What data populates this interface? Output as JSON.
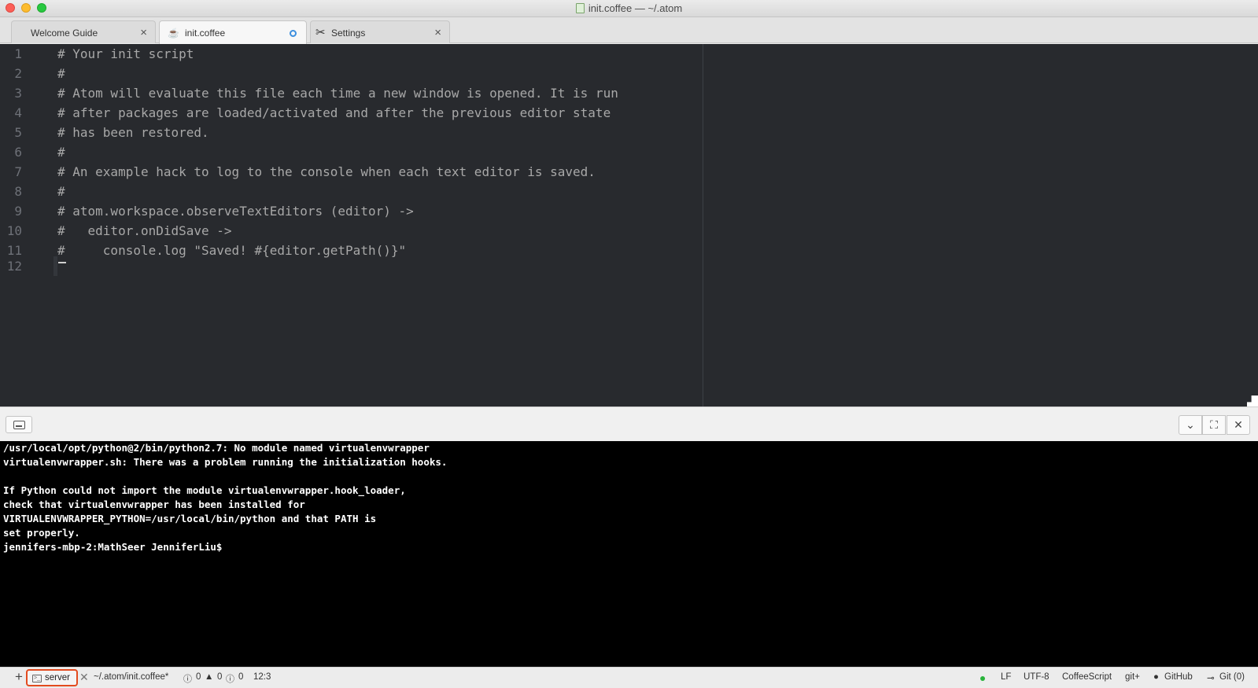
{
  "window": {
    "title": "init.coffee — ~/.atom"
  },
  "tabs": [
    {
      "label": "Welcome Guide",
      "state": "close"
    },
    {
      "label": "init.coffee",
      "state": "modified"
    },
    {
      "label": "Settings",
      "state": "close"
    }
  ],
  "editor": {
    "line_numbers": [
      "1",
      "2",
      "3",
      "4",
      "5",
      "6",
      "7",
      "8",
      "9",
      "10",
      "11",
      "12"
    ],
    "lines": [
      "# Your init script",
      "#",
      "# Atom will evaluate this file each time a new window is opened. It is run",
      "# after packages are loaded/activated and after the previous editor state",
      "# has been restored.",
      "#",
      "# An example hack to log to the console when each text editor is saved.",
      "#",
      "# atom.workspace.observeTextEditors (editor) ->",
      "#   editor.onDidSave ->",
      "#     console.log \"Saved! #{editor.getPath()}\"",
      ""
    ]
  },
  "terminal": {
    "lines": [
      "/usr/local/opt/python@2/bin/python2.7: No module named virtualenvwrapper",
      "virtualenvwrapper.sh: There was a problem running the initialization hooks.",
      "",
      "If Python could not import the module virtualenvwrapper.hook_loader,",
      "check that virtualenvwrapper has been installed for",
      "VIRTUALENVWRAPPER_PYTHON=/usr/local/bin/python and that PATH is",
      "set properly.",
      "jennifers-mbp-2:MathSeer JenniferLiu$"
    ]
  },
  "statusbar": {
    "add": "+",
    "terminal_tab": "server",
    "close": "✕",
    "file_path": "~/.atom/init.coffee*",
    "errors": "0",
    "warnings": "0",
    "infos": "0",
    "cursor_position": "12:3",
    "line_ending": "LF",
    "encoding": "UTF-8",
    "grammar": "CoffeeScript",
    "git_plus": "git+",
    "github": "GitHub",
    "git": "Git (0)"
  },
  "colors": {
    "editor_bg": "#282a2e",
    "terminal_bg": "#000000",
    "highlight_border": "#e34b1f",
    "modified_dot": "#3c8fde"
  }
}
